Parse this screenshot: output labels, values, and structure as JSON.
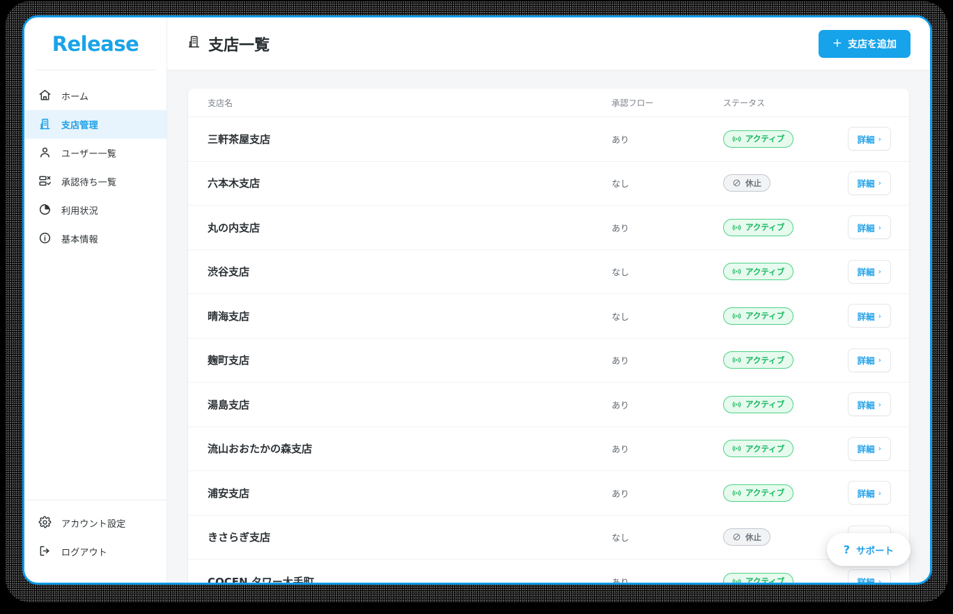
{
  "brand": {
    "logo_text": "Release",
    "accent_color": "#16a3ea",
    "active_nav_bg": "#e7f4fd"
  },
  "sidebar": {
    "items": [
      {
        "label": "ホーム",
        "icon": "home-icon",
        "active": false
      },
      {
        "label": "支店管理",
        "icon": "building-icon",
        "active": true
      },
      {
        "label": "ユーザー一覧",
        "icon": "user-icon",
        "active": false
      },
      {
        "label": "承認待ち一覧",
        "icon": "approval-list-icon",
        "active": false
      },
      {
        "label": "利用状況",
        "icon": "pie-chart-icon",
        "active": false
      },
      {
        "label": "基本情報",
        "icon": "info-icon",
        "active": false
      }
    ],
    "bottom_items": [
      {
        "label": "アカウント設定",
        "icon": "gear-icon"
      },
      {
        "label": "ログアウト",
        "icon": "logout-icon"
      }
    ]
  },
  "header": {
    "title": "支店一覧",
    "title_icon": "building-icon",
    "add_button": {
      "label": "支店を追加",
      "plus": "+"
    }
  },
  "table": {
    "columns": [
      "支店名",
      "承認フロー",
      "ステータス"
    ],
    "detail_label": "詳細",
    "detail_chevron": "›",
    "status_icons": {
      "active": "broadcast-icon",
      "paused": "prohibited-icon"
    },
    "rows": [
      {
        "name": "三軒茶屋支店",
        "flow": "あり",
        "status": "アクティブ",
        "status_type": "active"
      },
      {
        "name": "六本木支店",
        "flow": "なし",
        "status": "休止",
        "status_type": "paused"
      },
      {
        "name": "丸の内支店",
        "flow": "あり",
        "status": "アクティブ",
        "status_type": "active"
      },
      {
        "name": "渋谷支店",
        "flow": "なし",
        "status": "アクティブ",
        "status_type": "active"
      },
      {
        "name": "晴海支店",
        "flow": "なし",
        "status": "アクティブ",
        "status_type": "active"
      },
      {
        "name": "麹町支店",
        "flow": "あり",
        "status": "アクティブ",
        "status_type": "active"
      },
      {
        "name": "湯島支店",
        "flow": "あり",
        "status": "アクティブ",
        "status_type": "active"
      },
      {
        "name": "流山おおたかの森支店",
        "flow": "あり",
        "status": "アクティブ",
        "status_type": "active"
      },
      {
        "name": "浦安支店",
        "flow": "あり",
        "status": "アクティブ",
        "status_type": "active"
      },
      {
        "name": "きさらぎ支店",
        "flow": "なし",
        "status": "休止",
        "status_type": "paused"
      },
      {
        "name": "COCEN タワー大手町",
        "flow": "あり",
        "status": "アクティブ",
        "status_type": "active"
      }
    ]
  },
  "support": {
    "label": "サポート",
    "icon_glyph": "?"
  }
}
